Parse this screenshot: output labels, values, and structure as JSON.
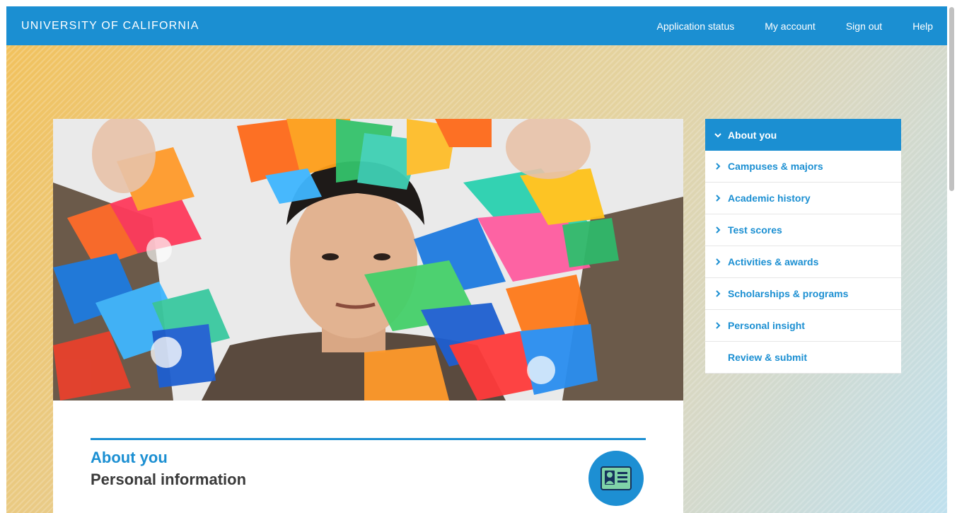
{
  "header": {
    "brand": "UNIVERSITY OF CALIFORNIA",
    "nav": [
      "Application status",
      "My account",
      "Sign out",
      "Help"
    ]
  },
  "hero": {
    "image": "student-with-colorful-paper-flowers"
  },
  "section": {
    "title": "About you",
    "subtitle": "Personal information",
    "icon": "id-card-icon"
  },
  "sidenav": {
    "items": [
      {
        "label": "About you",
        "icon": "chevron-down-icon",
        "active": true
      },
      {
        "label": "Campuses & majors",
        "icon": "chevron-right-icon"
      },
      {
        "label": "Academic history",
        "icon": "chevron-right-icon"
      },
      {
        "label": "Test scores",
        "icon": "chevron-right-icon"
      },
      {
        "label": "Activities & awards",
        "icon": "chevron-right-icon"
      },
      {
        "label": "Scholarships & programs",
        "icon": "chevron-right-icon"
      },
      {
        "label": "Personal insight",
        "icon": "chevron-right-icon"
      },
      {
        "label": "Review & submit",
        "icon": ""
      }
    ]
  },
  "colors": {
    "brand_blue": "#1b8fd2",
    "text_dark": "#3a3a3a"
  }
}
